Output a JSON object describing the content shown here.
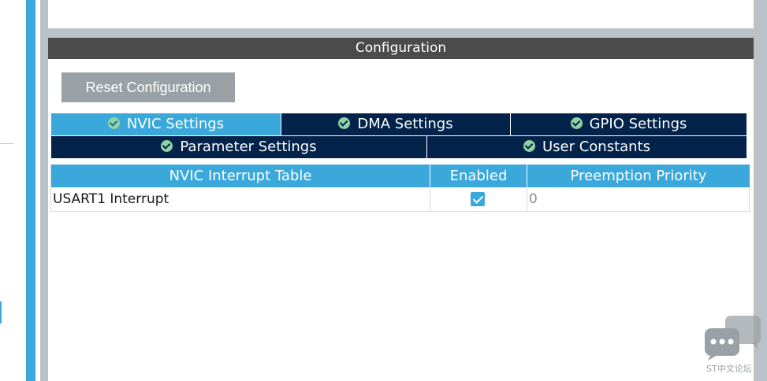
{
  "config": {
    "header": "Configuration",
    "reset_label": "Reset Configuration"
  },
  "tabs": [
    {
      "label": "NVIC Settings",
      "active": true
    },
    {
      "label": "DMA Settings",
      "active": false
    },
    {
      "label": "GPIO Settings",
      "active": false
    },
    {
      "label": "Parameter Settings",
      "active": false
    },
    {
      "label": "User Constants",
      "active": false
    }
  ],
  "table": {
    "headers": [
      "NVIC Interrupt Table",
      "Enabled",
      "Preemption Priority"
    ],
    "rows": [
      {
        "name": "USART1 Interrupt",
        "enabled": true,
        "priority": "0"
      }
    ]
  },
  "watermark": {
    "text": "ST中文论坛",
    "icon": "chat-bubble-icon"
  },
  "colors": {
    "accent_blue": "#3ba8db",
    "dark_navy": "#03234b",
    "header_gray": "#4b4b4b",
    "button_gray": "#9aa1a6",
    "check_green": "#8fd3a0"
  }
}
